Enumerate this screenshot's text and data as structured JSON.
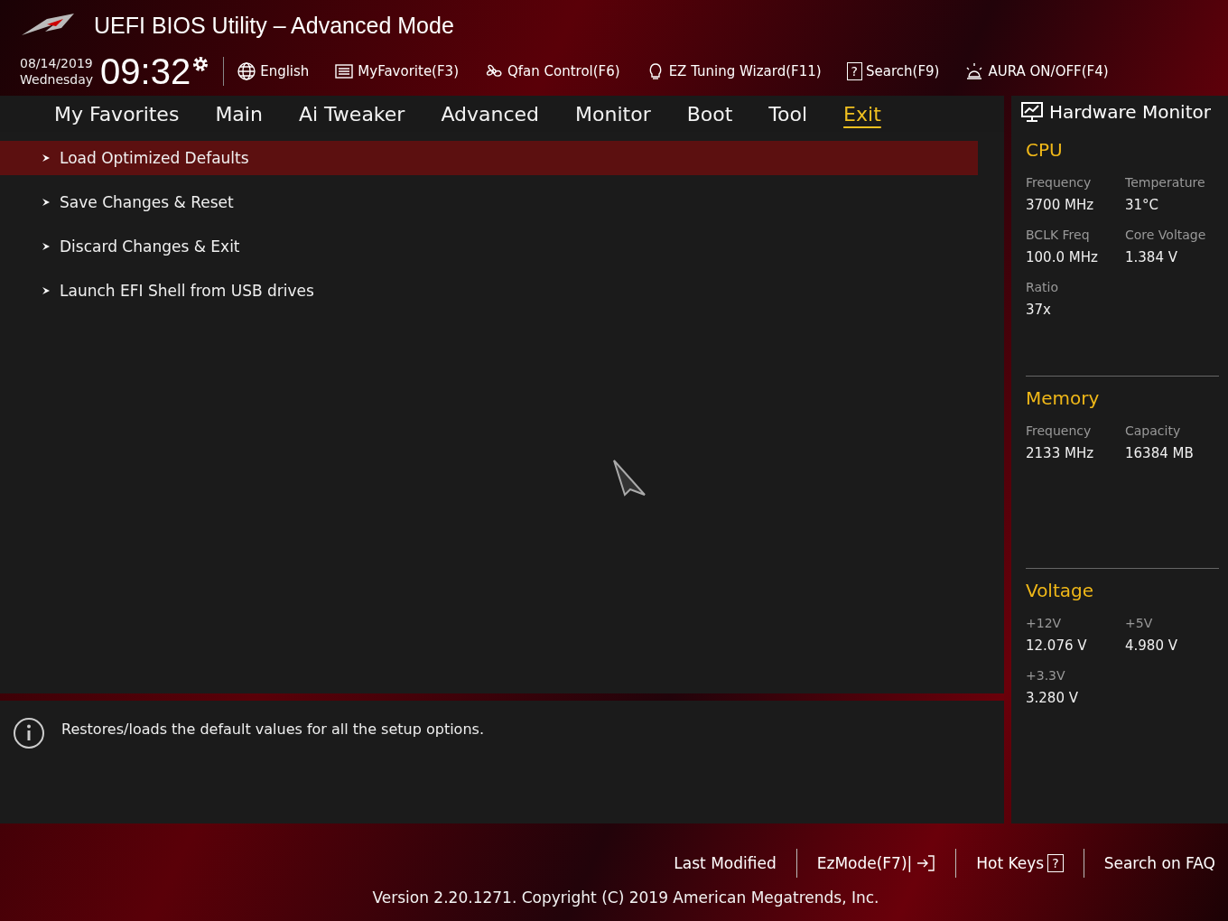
{
  "header": {
    "title": "UEFI BIOS Utility – Advanced Mode",
    "date": "08/14/2019",
    "weekday": "Wednesday",
    "time": "09:32",
    "tools": [
      {
        "label": "English",
        "kind": "globe"
      },
      {
        "label": "MyFavorite(F3)",
        "kind": "list"
      },
      {
        "label": "Qfan Control(F6)",
        "kind": "fan"
      },
      {
        "label": "EZ Tuning Wizard(F11)",
        "kind": "bulb"
      },
      {
        "label": "Search(F9)",
        "kind": "glyph",
        "glyph": "?"
      },
      {
        "label": "AURA ON/OFF(F4)",
        "kind": "aura"
      }
    ]
  },
  "tabs": [
    {
      "label": "My Favorites",
      "selected": false
    },
    {
      "label": "Main",
      "selected": false
    },
    {
      "label": "Ai Tweaker",
      "selected": false
    },
    {
      "label": "Advanced",
      "selected": false
    },
    {
      "label": "Monitor",
      "selected": false
    },
    {
      "label": "Boot",
      "selected": false
    },
    {
      "label": "Tool",
      "selected": false
    },
    {
      "label": "Exit",
      "selected": true
    }
  ],
  "menu": [
    {
      "label": "Load Optimized Defaults",
      "selected": true
    },
    {
      "label": "Save Changes & Reset",
      "selected": false
    },
    {
      "label": "Discard Changes & Exit",
      "selected": false
    },
    {
      "label": "Launch EFI Shell from USB drives",
      "selected": false
    }
  ],
  "help": "Restores/loads the default values for all the setup options.",
  "monitor": {
    "title": "Hardware Monitor",
    "sections": [
      {
        "title": "CPU",
        "fields": [
          {
            "label": "Frequency",
            "value": "3700 MHz"
          },
          {
            "label": "Temperature",
            "value": "31°C"
          },
          {
            "label": "BCLK Freq",
            "value": "100.0 MHz"
          },
          {
            "label": "Core Voltage",
            "value": "1.384 V"
          },
          {
            "label": "Ratio",
            "value": "37x"
          }
        ]
      },
      {
        "title": "Memory",
        "fields": [
          {
            "label": "Frequency",
            "value": "2133 MHz"
          },
          {
            "label": "Capacity",
            "value": "16384 MB"
          }
        ]
      },
      {
        "title": "Voltage",
        "fields": [
          {
            "label": "+12V",
            "value": "12.076 V"
          },
          {
            "label": "+5V",
            "value": "4.980 V"
          },
          {
            "label": "+3.3V",
            "value": "3.280 V"
          }
        ]
      }
    ]
  },
  "footer": {
    "links": [
      {
        "label": "Last Modified",
        "kind": "plain"
      },
      {
        "label": "EzMode(F7)|",
        "kind": "exit"
      },
      {
        "label": "Hot Keys",
        "kind": "glyph",
        "glyph": "?"
      },
      {
        "label": "Search on FAQ",
        "kind": "plain"
      }
    ],
    "version": "Version 2.20.1271. Copyright (C) 2019 American Megatrends, Inc."
  }
}
